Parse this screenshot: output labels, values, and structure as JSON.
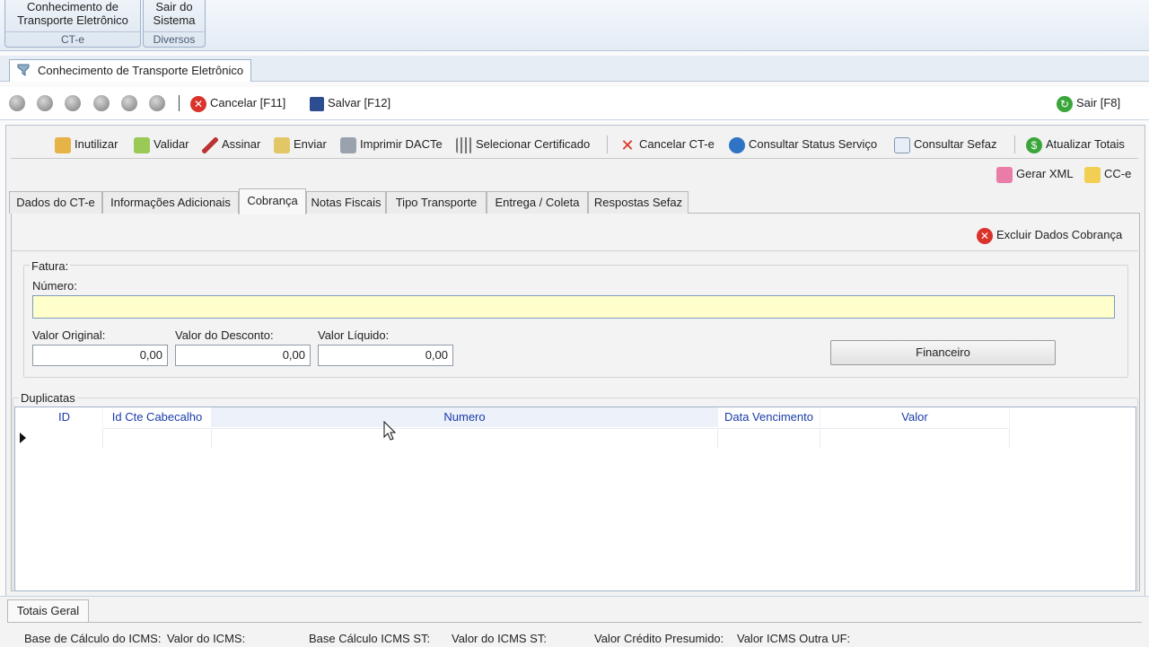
{
  "ribbon": {
    "groups": [
      {
        "button": "Conhecimento de Transporte Eletrônico",
        "caption": "CT-e"
      },
      {
        "button": "Sair do Sistema",
        "caption": "Diversos"
      }
    ]
  },
  "doc_tab": {
    "title": "Conhecimento de Transporte Eletrônico"
  },
  "toolbar": {
    "cancel_label": "Cancelar [F11]",
    "save_label": "Salvar [F12]",
    "exit_label": "Sair [F8]"
  },
  "actions": {
    "inutilizar": "Inutilizar",
    "validar": "Validar",
    "assinar": "Assinar",
    "enviar": "Enviar",
    "imprimir": "Imprimir DACTe",
    "certificado": "Selecionar Certificado",
    "cancelar_cte": "Cancelar CT-e",
    "status": "Consultar Status Serviço",
    "consultar_sefaz": "Consultar Sefaz",
    "atualizar": "Atualizar Totais",
    "gerar_xml": "Gerar XML",
    "cce": "CC-e"
  },
  "tabs": [
    {
      "label": "Dados do CT-e"
    },
    {
      "label": "Informações Adicionais"
    },
    {
      "label": "Cobrança"
    },
    {
      "label": "Notas Fiscais"
    },
    {
      "label": "Tipo Transporte"
    },
    {
      "label": "Entrega / Coleta"
    },
    {
      "label": "Respostas Sefaz"
    }
  ],
  "cobranca": {
    "excluir_label": "Excluir Dados Cobrança",
    "fatura_legend": "Fatura:",
    "numero_label": "Número:",
    "numero_value": "",
    "valor_original_label": "Valor Original:",
    "valor_original": "0,00",
    "valor_desconto_label": "Valor do Desconto:",
    "valor_desconto": "0,00",
    "valor_liquido_label": "Valor Líquido:",
    "valor_liquido": "0,00",
    "financeiro_label": "Financeiro",
    "duplicatas_legend": "Duplicatas"
  },
  "grid": {
    "columns": [
      "ID",
      "Id Cte Cabecalho",
      "Numero",
      "Data Vencimento",
      "Valor"
    ]
  },
  "bottom": {
    "tab": "Totais Geral",
    "labels": [
      "Base de Cálculo do ICMS:",
      "Valor do ICMS:",
      "Base Cálculo ICMS ST:",
      "Valor do ICMS ST:",
      "Valor Crédito Presumido:",
      "Valor ICMS Outra UF:"
    ]
  },
  "colors": {
    "required_field": "#ffffcc",
    "grid_header_text": "#1a3ba8"
  }
}
